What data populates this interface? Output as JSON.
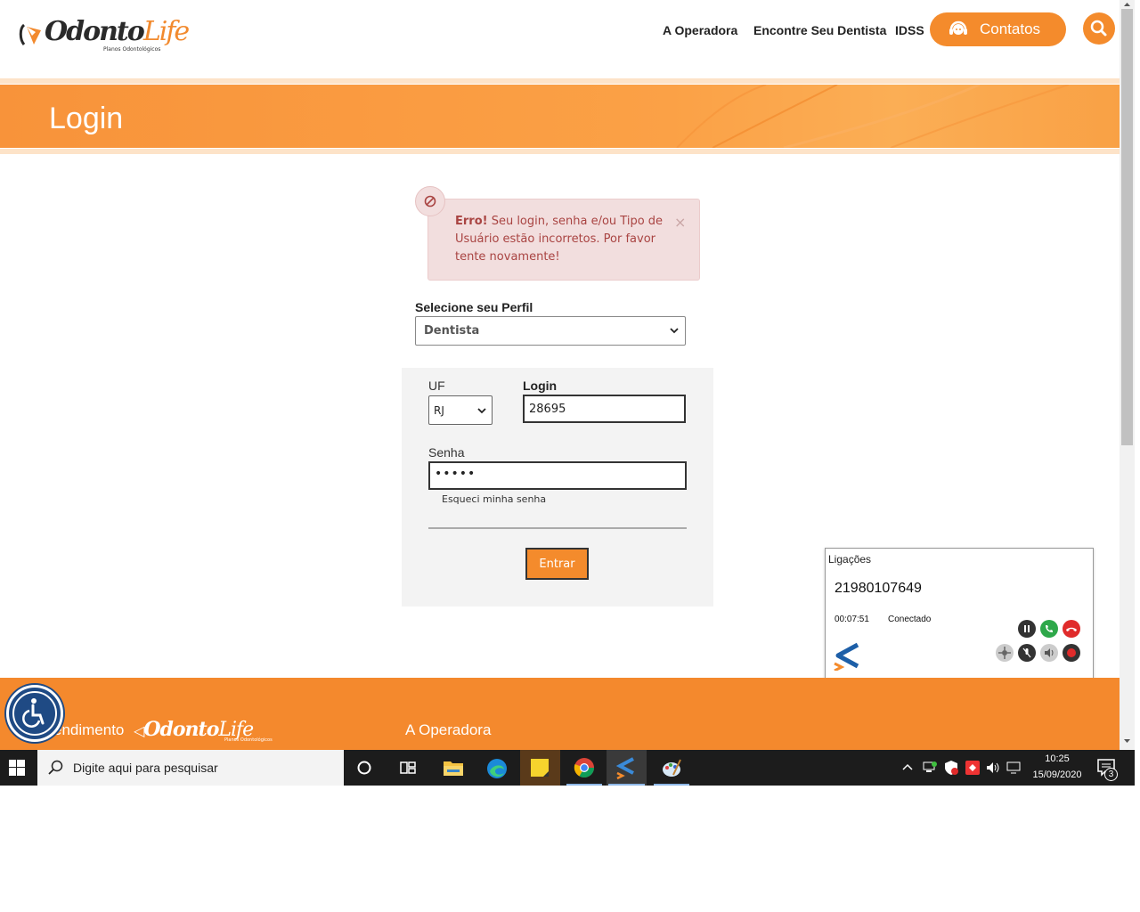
{
  "header": {
    "logo": {
      "brand_left": "Odonto",
      "brand_right": "Life",
      "tagline": "Planos Odontológicos"
    },
    "nav": [
      "A Operadora",
      "Encontre Seu Dentista",
      "IDSS"
    ],
    "contatos_label": "Contatos"
  },
  "banner": {
    "title": "Login"
  },
  "error": {
    "prefix": "Erro!",
    "message": " Seu login, senha e/ou Tipo de Usuário estão incorretos. Por favor tente novamente!",
    "close": "×"
  },
  "profile": {
    "label": "Selecione seu Perfil",
    "selected": "Dentista"
  },
  "form": {
    "uf_label": "UF",
    "uf_value": "RJ",
    "login_label": "Login",
    "login_value": "28695",
    "senha_label": "Senha",
    "senha_value": "•••••",
    "forgot": "Esqueci minha senha",
    "submit": "Entrar"
  },
  "footer": {
    "atendimento": "endimento",
    "logo_left": "Odonto",
    "logo_right": "Life",
    "logo_tagline": "Planos Odontológicos",
    "operadora": "A Operadora"
  },
  "calls": {
    "title": "Ligações",
    "number": "21980107649",
    "duration": "00:07:51",
    "status": "Conectado"
  },
  "taskbar": {
    "search_placeholder": "Digite aqui para pesquisar",
    "time": "10:25",
    "date": "15/09/2020",
    "notification_count": "3"
  },
  "colors": {
    "accent": "#f48b2c",
    "error_bg": "#f2dede",
    "error_text": "#a94442",
    "access_blue": "#1f4a84"
  }
}
